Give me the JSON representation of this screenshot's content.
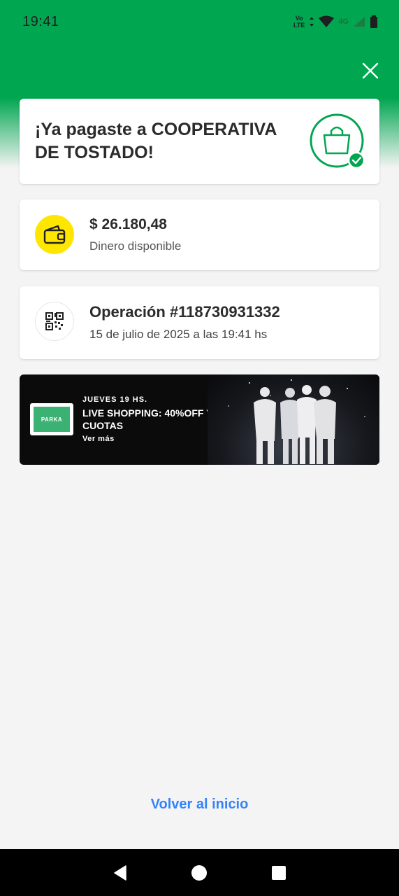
{
  "status_bar": {
    "time": "19:41",
    "volte_top": "Vo",
    "volte_bottom": "LTE",
    "network": "4G"
  },
  "success_card": {
    "message": "¡Ya pagaste a COOPERATIVA DE TOSTADO!",
    "icon": "shopping-bag-check-icon"
  },
  "balance_card": {
    "amount": "$ 26.180,48",
    "label": "Dinero disponible",
    "icon": "wallet-icon"
  },
  "operation_card": {
    "title": "Operación #118730931332",
    "date": "15 de julio de 2025 a las 19:41 hs",
    "icon": "qr-code-icon"
  },
  "banner": {
    "logo_text": "PARKA",
    "kicker": "JUEVES 19 HS.",
    "title": "LIVE SHOPPING: 40%OFF Y 6 CUOTAS",
    "cta": "Ver más"
  },
  "footer": {
    "back_link": "Volver al inicio"
  },
  "colors": {
    "brand_green": "#00a650",
    "link_blue": "#3483fa",
    "wallet_yellow": "#ffe600"
  }
}
